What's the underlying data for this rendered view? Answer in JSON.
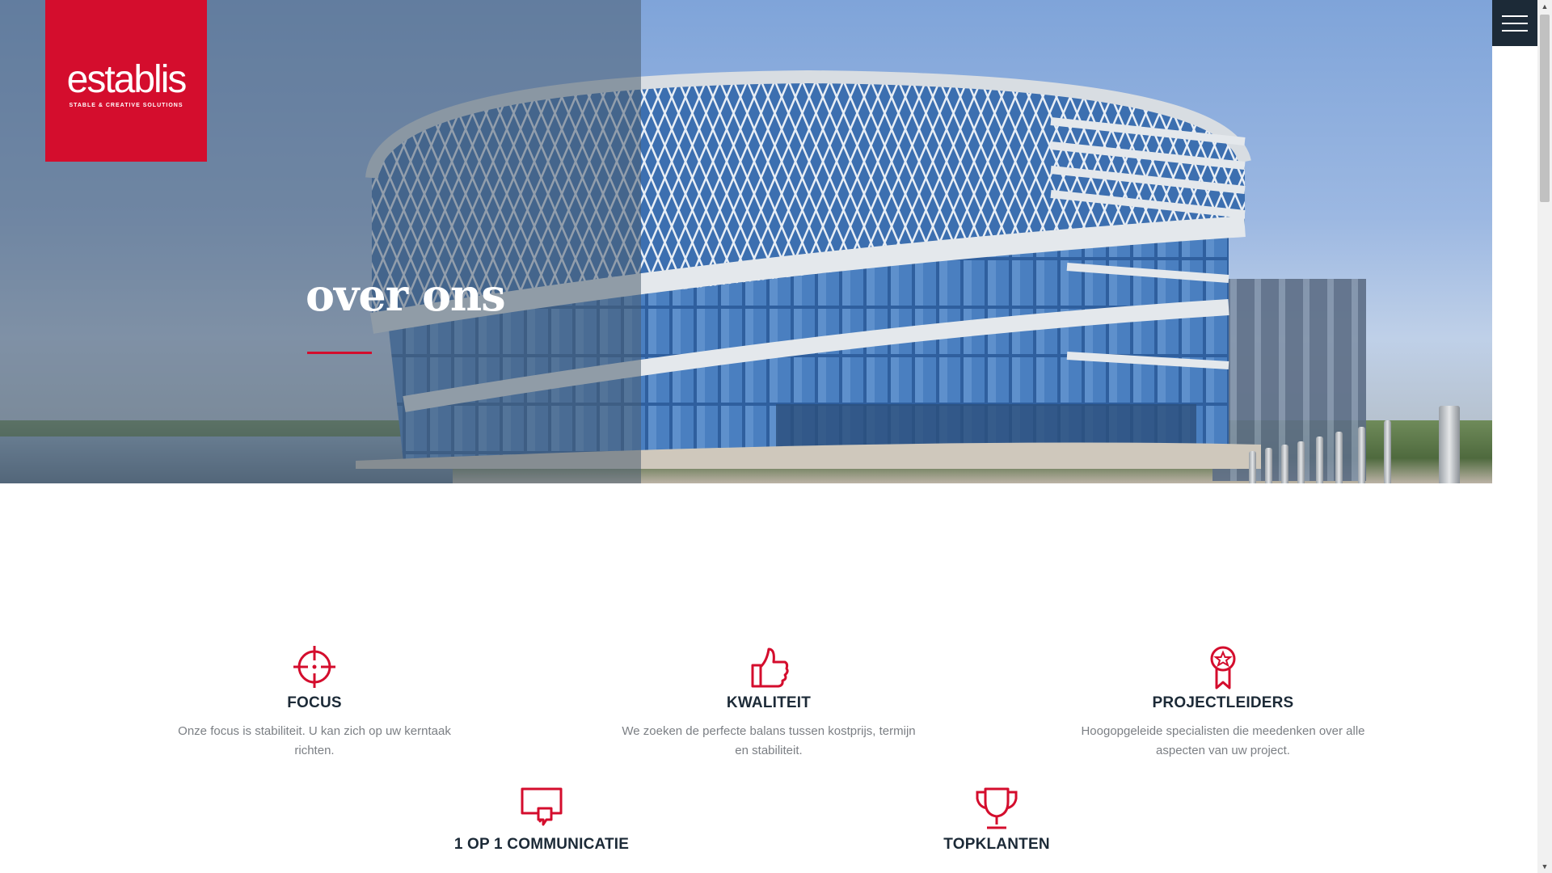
{
  "brand": {
    "name": "establis",
    "tagline": "STABLE & CREATIVE SOLUTIONS",
    "color": "#d40d2d"
  },
  "hero": {
    "title": "over ons"
  },
  "nav": {
    "menu_icon": "hamburger-icon"
  },
  "features": [
    {
      "icon": "crosshair-icon",
      "title": "FOCUS",
      "text": "Onze focus is stabiliteit. U kan zich op uw kerntaak richten."
    },
    {
      "icon": "thumbs-up-icon",
      "title": "KWALITEIT",
      "text": "We zoeken de perfecte balans tussen kostprijs, termijn en stabiliteit."
    },
    {
      "icon": "award-ribbon-icon",
      "title": "PROJECTLEIDERS",
      "text": "Hoogopgeleide specialisten die meedenken over alle aspecten van uw project."
    },
    {
      "icon": "chat-bubbles-icon",
      "title": "1 OP 1 COMMUNICATIE",
      "text": ""
    },
    {
      "icon": "trophy-icon",
      "title": "TOPKLANTEN",
      "text": ""
    }
  ],
  "colors": {
    "accent": "#d40d2d",
    "heading": "#1c2a37",
    "body_text": "#7b7f84",
    "menu_bg": "#1c2a37"
  }
}
